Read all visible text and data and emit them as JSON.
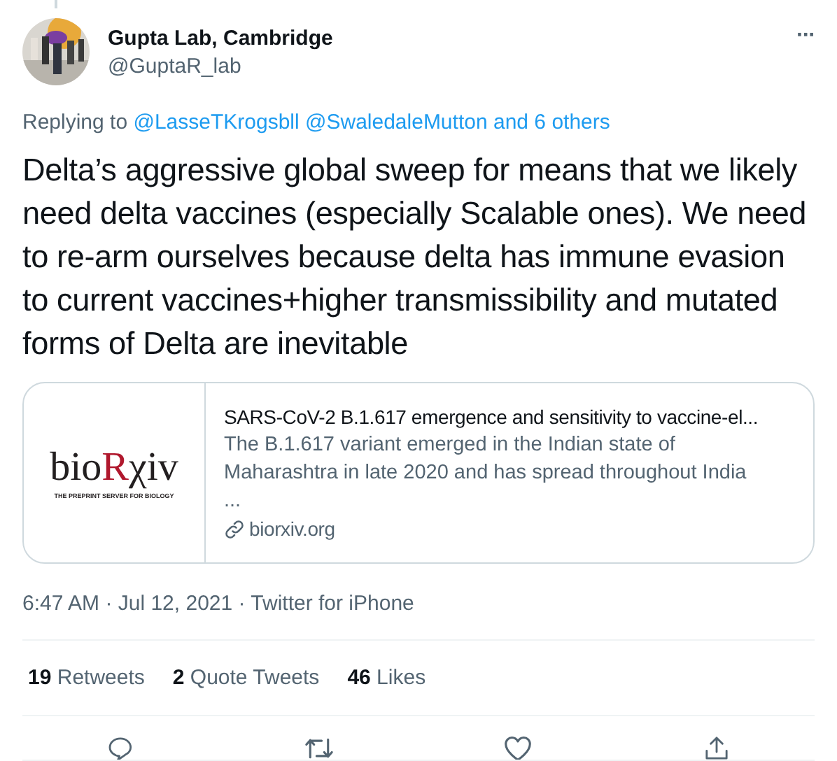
{
  "author": {
    "name": "Gupta Lab, Cambridge",
    "handle": "@GuptaR_lab"
  },
  "more_menu": "···",
  "replying": {
    "label": "Replying to",
    "mentions": [
      "@LasseTKrogsbll",
      "@SwaledaleMutton",
      "and 6 others"
    ]
  },
  "text": "Delta’s aggressive global sweep for means that we likely need delta vaccines (especially Scalable ones). We need to re-arm ourselves because delta has immune evasion to current vaccines+higher transmissibility and mutated forms of Delta are inevitable",
  "card": {
    "logo": {
      "prefix": "bio",
      "accent": "R",
      "suffix": "χiv",
      "tagline": "THE PREPRINT SERVER FOR BIOLOGY"
    },
    "title": "SARS-CoV-2 B.1.617 emergence and sensitivity to vaccine-el...",
    "description": "The B.1.617 variant emerged in the Indian state of Maharashtra in late 2020 and has spread throughout India ...",
    "domain": "biorxiv.org"
  },
  "meta": "6:47 AM · Jul 12, 2021 · Twitter for iPhone",
  "stats": [
    {
      "count": "19",
      "label": "Retweets"
    },
    {
      "count": "2",
      "label": "Quote Tweets"
    },
    {
      "count": "46",
      "label": "Likes"
    }
  ],
  "actions": [
    {
      "kind": "reply"
    },
    {
      "kind": "retweet"
    },
    {
      "kind": "like"
    },
    {
      "kind": "share"
    }
  ]
}
